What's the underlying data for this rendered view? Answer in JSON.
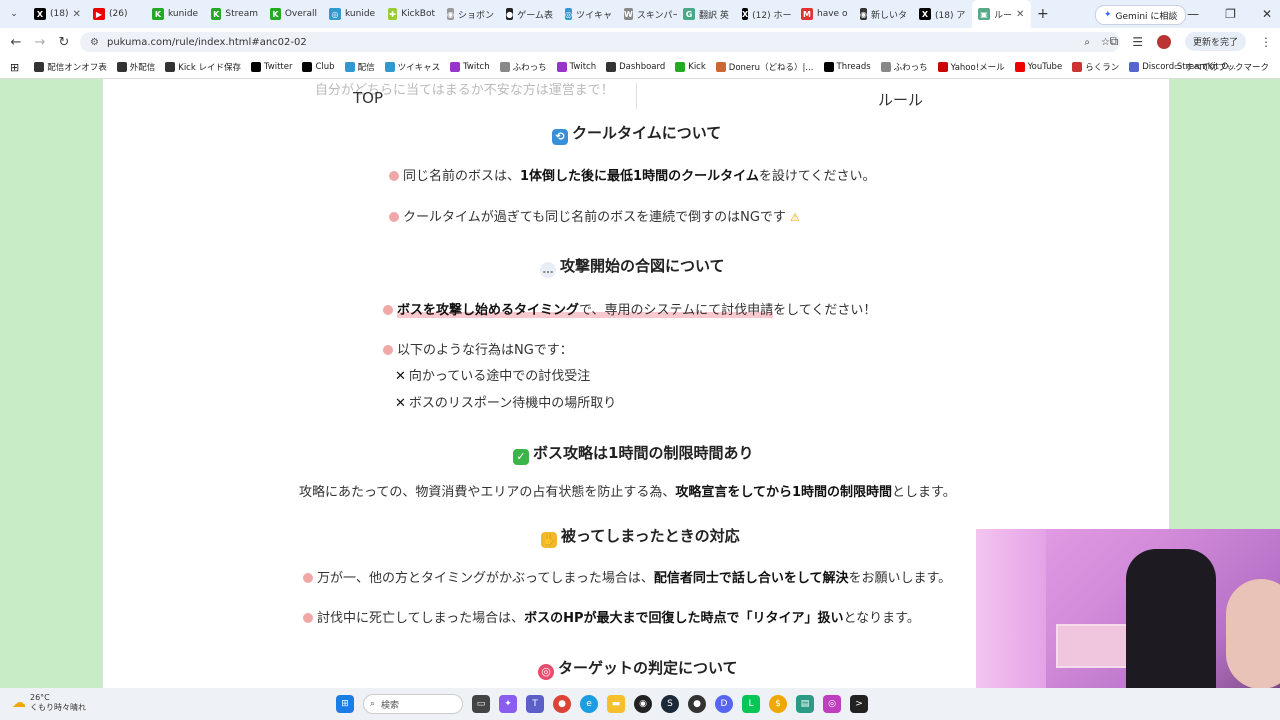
{
  "browser": {
    "tabs": [
      {
        "label": "(18)",
        "fav": "X",
        "color": "#000"
      },
      {
        "label": "(26)",
        "fav": "▶",
        "color": "#e00"
      },
      {
        "label": "kunide",
        "fav": "K",
        "color": "#2a2"
      },
      {
        "label": "Stream",
        "fav": "K",
        "color": "#2a2"
      },
      {
        "label": "Overall",
        "fav": "K",
        "color": "#2a2"
      },
      {
        "label": "kunide",
        "fav": "◎",
        "color": "#39c"
      },
      {
        "label": "KickBot",
        "fav": "✚",
        "color": "#9c3"
      },
      {
        "label": "ショボン",
        "fav": "◉",
        "color": "#999"
      },
      {
        "label": "ゲーム表",
        "fav": "●",
        "color": "#222"
      },
      {
        "label": "ツイキャ",
        "fav": "◎",
        "color": "#39c"
      },
      {
        "label": "スキンパー",
        "fav": "W",
        "color": "#888"
      },
      {
        "label": "翻訳 英",
        "fav": "G",
        "color": "#4a8"
      },
      {
        "label": "(12) ホー",
        "fav": "X",
        "color": "#000"
      },
      {
        "label": "have o",
        "fav": "M",
        "color": "#d33"
      },
      {
        "label": "新しいタ",
        "fav": "◉",
        "color": "#333"
      },
      {
        "label": "(18) ア",
        "fav": "X",
        "color": "#000"
      },
      {
        "label": "ルー",
        "fav": "▣",
        "color": "#5a8"
      }
    ],
    "new_tab": "+",
    "gemini_label": "Gemini に相談",
    "url": "pukuma.com/rule/index.html#anc02-02",
    "update_label": "更新を完了",
    "bookmarks": [
      {
        "label": "配信オンオフ表",
        "color": "#333"
      },
      {
        "label": "外配信",
        "color": "#333"
      },
      {
        "label": "Kick レイド保存",
        "color": "#333"
      },
      {
        "label": "Twitter",
        "color": "#000"
      },
      {
        "label": "Club",
        "color": "#000"
      },
      {
        "label": "配信",
        "color": "#39c"
      },
      {
        "label": "ツイキャス",
        "color": "#39c"
      },
      {
        "label": "Twitch",
        "color": "#93c"
      },
      {
        "label": "ふわっち",
        "color": "#888"
      },
      {
        "label": "Twitch",
        "color": "#93c"
      },
      {
        "label": "Dashboard",
        "color": "#333"
      },
      {
        "label": "Kick",
        "color": "#2a2"
      },
      {
        "label": "Doneru（どねる）|...",
        "color": "#c63"
      },
      {
        "label": "Threads",
        "color": "#000"
      },
      {
        "label": "ふわっち",
        "color": "#888"
      },
      {
        "label": "Yahoo!メール",
        "color": "#c00"
      },
      {
        "label": "YouTube",
        "color": "#e00"
      },
      {
        "label": "らくラン",
        "color": "#c33"
      },
      {
        "label": "Discord StreamKit O...",
        "color": "#56c"
      }
    ],
    "all_bookmarks": "すべてのブックマーク"
  },
  "site_nav": {
    "ghost_text": "自分がどちらに当てはまるか不安な方は運営まで！",
    "top": "TOP",
    "rule": "ルール"
  },
  "sections": {
    "cooltime": {
      "title": "クールタイムについて",
      "l1_pre": "同じ名前のボスは、",
      "l1_bold": "1体倒した後に最低1時間のクールタイム",
      "l1_post": "を設けてください。",
      "l2": "クールタイムが過ぎても同じ名前のボスを連続で倒すのはNGです",
      "l2_emoji": "⚠"
    },
    "attack": {
      "title": "攻撃開始の合図について",
      "l1_bold": "ボスを攻撃し始めるタイミング",
      "l1_mid": "で、専用のシステムにて討伐申請",
      "l1_post": "をしてください！",
      "l2": "以下のような行為はNGです：",
      "ng1": "向かっている途中での討伐受注",
      "ng2": "ボスのリスポーン待機中の場所取り"
    },
    "limit": {
      "title": "ボス攻略は1時間の制限時間あり",
      "l1_pre": "攻略にあたっての、物資消費やエリアの占有状態を防止する為、",
      "l1_bold": "攻略宣言をしてから1時間の制限時間",
      "l1_post": "とします。"
    },
    "overlap": {
      "title": "被ってしまったときの対応",
      "l1_pre": "万が一、他の方とタイミングがかぶってしまった場合は、",
      "l1_bold": "配信者同士で話し合いをして解決",
      "l1_post": "をお願いします。",
      "l2_pre": "討伐中に死亡してしまった場合は、",
      "l2_bold": "ボスのHPが最大まで回復した時点で「リタイア」扱い",
      "l2_post": "となります。"
    },
    "target": {
      "title": "ターゲットの判定について"
    }
  },
  "taskbar": {
    "temp": "26°C",
    "weather": "くもり時々晴れ",
    "search": "検索"
  }
}
